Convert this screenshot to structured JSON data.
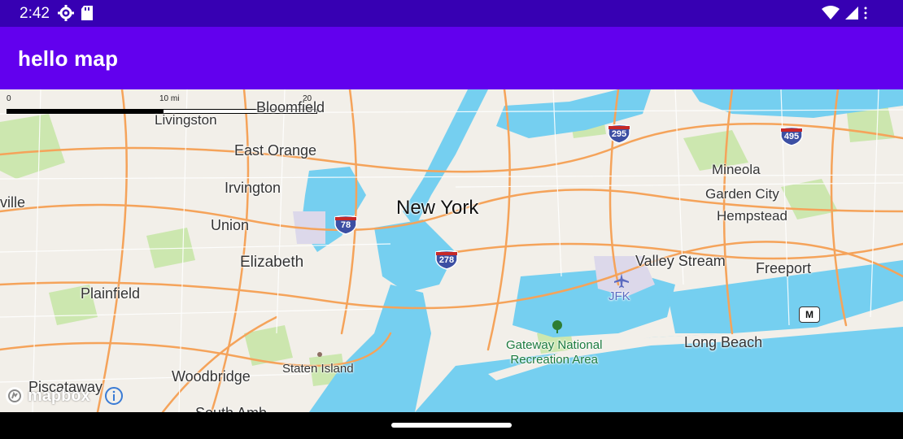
{
  "status_bar": {
    "time": "2:42",
    "icons_left": [
      "settings-gear-icon",
      "sd-card-icon"
    ],
    "icons_right": [
      "wifi-icon",
      "cellular-signal-icon",
      "overflow-dots-icon"
    ]
  },
  "app_bar": {
    "title": "hello map"
  },
  "map": {
    "colors": {
      "land": "#f2efe9",
      "water": "#75cff0",
      "park": "#c8e6a8",
      "road_major": "#f5a35a",
      "road_minor": "#ffffff",
      "interstate_shield": "#3c4fa3"
    },
    "scale_bar": {
      "left_label": "0",
      "mid_label": "10 mi",
      "right_label": "20 mi"
    },
    "labels": {
      "new_york": "New York",
      "bloomfield": "Bloomfield",
      "livingston": "Livingston",
      "east_orange": "East Orange",
      "irvington": "Irvington",
      "union": "Union",
      "elizabeth": "Elizabeth",
      "plainfield": "Plainfield",
      "ville": "ville",
      "piscataway": "Piscataway",
      "woodbridge": "Woodbridge",
      "staten_island": "Staten Island",
      "mineola": "Mineola",
      "garden_city": "Garden City",
      "hempstead": "Hempstead",
      "valley_stream": "Valley Stream",
      "freeport": "Freeport",
      "long_beach": "Long Beach",
      "jfk": "JFK",
      "gateway_line1": "Gateway National",
      "gateway_line2": "Recreation Area",
      "south_amboy_partial": "South Amb"
    },
    "shields": {
      "i295": "295",
      "i495": "495",
      "i78": "78",
      "i278": "278",
      "m": "M"
    },
    "attribution": {
      "logo_text": "mapbox",
      "info_icon": "info-icon"
    }
  }
}
